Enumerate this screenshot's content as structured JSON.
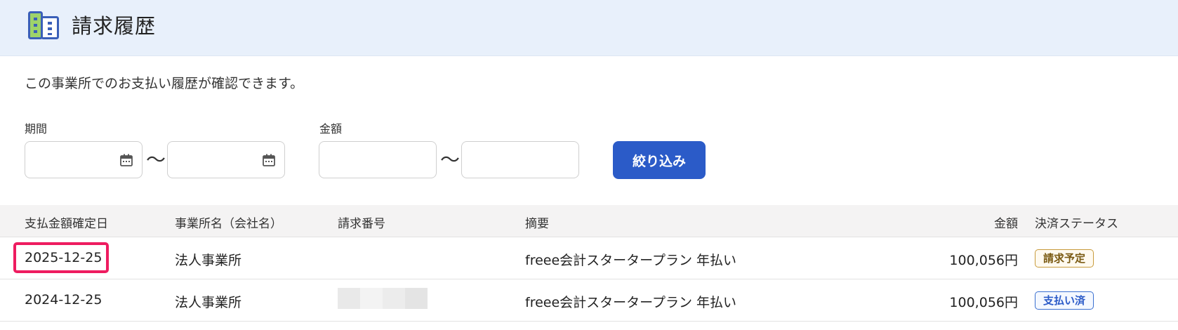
{
  "header": {
    "title": "請求履歴",
    "icon": "building-icon"
  },
  "description": "この事業所でのお支払い履歴が確認できます。",
  "filters": {
    "period_label": "期間",
    "amount_label": "金額",
    "period_from": "",
    "period_to": "",
    "amount_from": "",
    "amount_to": "",
    "range_separator": "〜",
    "submit_label": "絞り込み"
  },
  "table": {
    "headers": [
      "支払金額確定日",
      "事業所名（会社名）",
      "請求番号",
      "摘要",
      "金額",
      "決済ステータス"
    ],
    "rows": [
      {
        "date": "2025-12-25",
        "company": "法人事業所",
        "invoice_no": "",
        "summary": "freee会計スタータープラン 年払い",
        "amount": "100,056円",
        "status": "請求予定"
      },
      {
        "date": "2024-12-25",
        "company": "法人事業所",
        "invoice_no": "",
        "summary": "freee会計スタータープラン 年払い",
        "amount": "100,056円",
        "status": "支払い済"
      }
    ]
  },
  "colors": {
    "accent": "#2b5bc8",
    "header_bg": "#e8f0fb",
    "highlight": "#ee1c60",
    "scheduled": "#c89b3c",
    "paid": "#3a6fd0"
  }
}
